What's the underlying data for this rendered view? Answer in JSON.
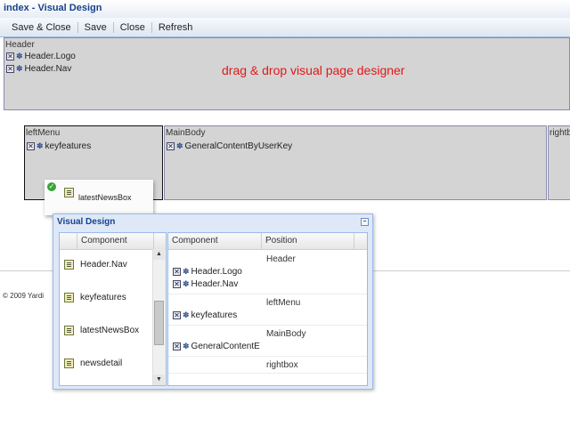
{
  "window": {
    "title": "index - Visual Design"
  },
  "toolbar": {
    "buttons": [
      {
        "label": "Save & Close"
      },
      {
        "label": "Save"
      },
      {
        "label": "Close"
      },
      {
        "label": "Refresh"
      }
    ]
  },
  "header": {
    "label": "Header",
    "components": [
      "Header.Logo",
      "Header.Nav"
    ],
    "banner": "drag & drop visual page designer"
  },
  "left_menu": {
    "label": "leftMenu",
    "components": [
      "keyfeatures"
    ]
  },
  "main_body": {
    "label": "MainBody",
    "components": [
      "GeneralContentByUserKey"
    ]
  },
  "right_box": {
    "label": "rightbox"
  },
  "drag_proxy": {
    "label": "latestNewsBox"
  },
  "footer": {
    "text": "© 2009 Yardi"
  },
  "dialog": {
    "title": "Visual Design",
    "left_grid": {
      "header": "Component",
      "items": [
        "Header.Nav",
        "keyfeatures",
        "latestNewsBox",
        "newsdetail"
      ]
    },
    "right_grid": {
      "headers": [
        "Component",
        "Position"
      ],
      "groups": [
        {
          "position": "Header",
          "components": [
            "Header.Logo",
            "Header.Nav"
          ]
        },
        {
          "position": "leftMenu",
          "components": [
            "keyfeatures"
          ]
        },
        {
          "position": "MainBody",
          "components": [
            "GeneralContentE"
          ]
        },
        {
          "position": "rightbox",
          "components": []
        }
      ]
    }
  }
}
